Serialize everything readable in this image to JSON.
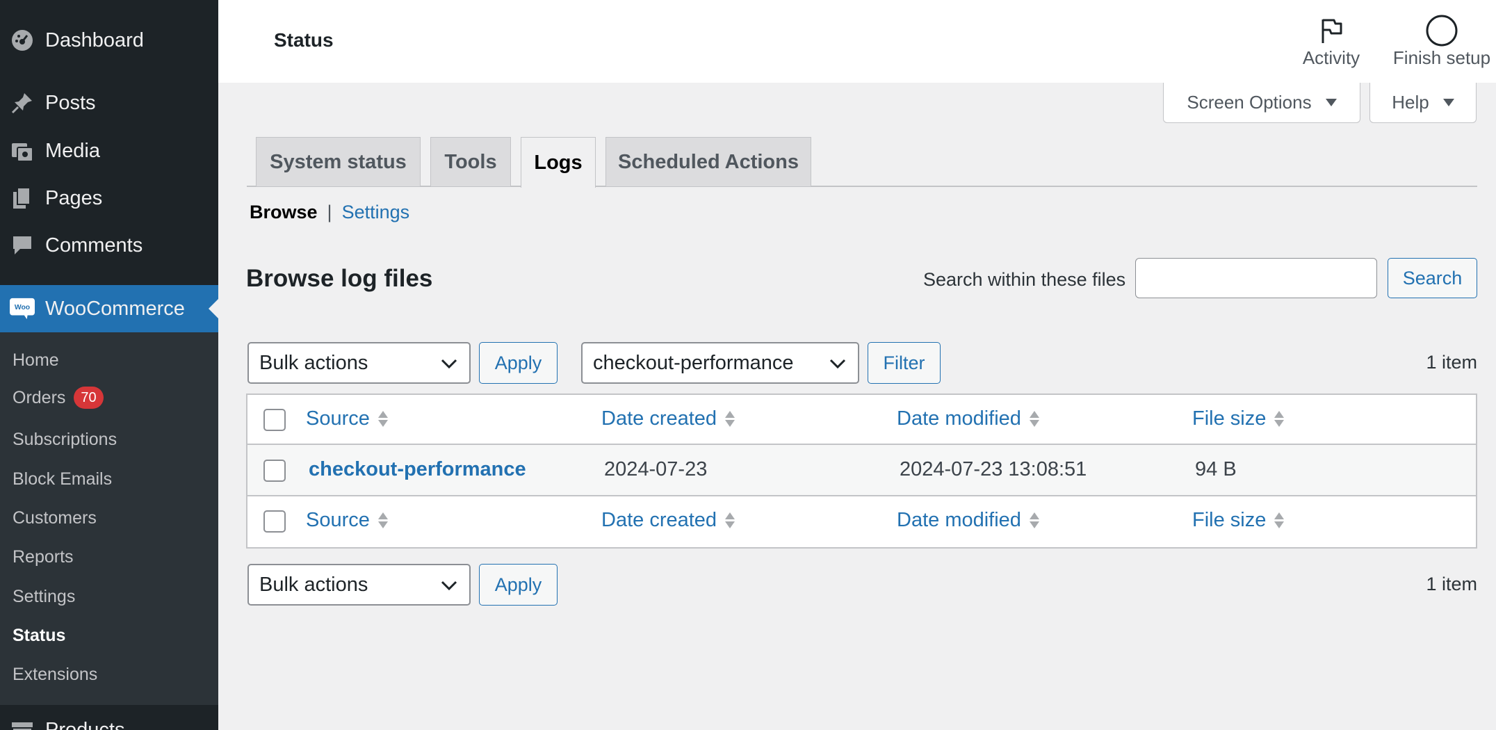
{
  "sidebar": {
    "items": [
      {
        "label": "Dashboard",
        "icon": "dashboard-icon"
      },
      {
        "label": "Posts",
        "icon": "pin-icon"
      },
      {
        "label": "Media",
        "icon": "media-icon"
      },
      {
        "label": "Pages",
        "icon": "pages-icon"
      },
      {
        "label": "Comments",
        "icon": "comment-icon"
      },
      {
        "label": "WooCommerce",
        "icon": "woo-icon"
      },
      {
        "label": "Products",
        "icon": "archive-icon"
      }
    ],
    "woo_logo_text": "Woo",
    "submenu": [
      {
        "label": "Home"
      },
      {
        "label": "Orders",
        "badge": "70"
      },
      {
        "label": "Subscriptions"
      },
      {
        "label": "Block Emails"
      },
      {
        "label": "Customers"
      },
      {
        "label": "Reports"
      },
      {
        "label": "Settings"
      },
      {
        "label": "Status",
        "current": true
      },
      {
        "label": "Extensions"
      }
    ]
  },
  "header": {
    "title": "Status",
    "activity_label": "Activity",
    "finish_setup_label": "Finish setup"
  },
  "screen_options": {
    "label": "Screen Options"
  },
  "help": {
    "label": "Help"
  },
  "tabs": [
    {
      "label": "System status"
    },
    {
      "label": "Tools"
    },
    {
      "label": "Logs",
      "active": true
    },
    {
      "label": "Scheduled Actions"
    }
  ],
  "subnav": {
    "current": "Browse",
    "separator": "|",
    "link": "Settings"
  },
  "main": {
    "heading": "Browse log files",
    "search_label": "Search within these files",
    "search_value": "",
    "search_button": "Search"
  },
  "toolbar_top": {
    "bulk_actions": "Bulk actions",
    "apply": "Apply",
    "source_filter": "checkout-performance",
    "filter": "Filter",
    "count": "1 item"
  },
  "table": {
    "columns": [
      "Source",
      "Date created",
      "Date modified",
      "File size"
    ],
    "rows": [
      [
        "checkout-performance",
        "2024-07-23",
        "2024-07-23 13:08:51",
        "94 B"
      ]
    ]
  },
  "toolbar_bottom": {
    "bulk_actions": "Bulk actions",
    "apply": "Apply",
    "count": "1 item"
  },
  "colors": {
    "sidebar_bg": "#1d2327",
    "submenu_bg": "#2c3338",
    "accent": "#2271b1",
    "badge": "#d63638"
  }
}
